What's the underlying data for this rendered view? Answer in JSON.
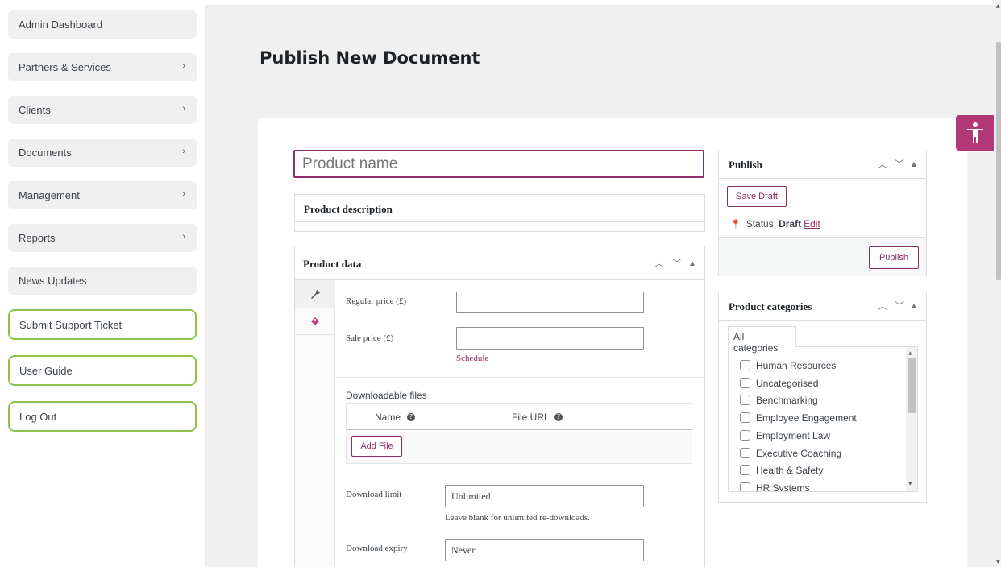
{
  "sidebar": {
    "items": [
      {
        "label": "Admin Dashboard",
        "has_chevron": false
      },
      {
        "label": "Partners & Services",
        "has_chevron": true
      },
      {
        "label": "Clients",
        "has_chevron": true
      },
      {
        "label": "Documents",
        "has_chevron": true
      },
      {
        "label": "Management",
        "has_chevron": true
      },
      {
        "label": "Reports",
        "has_chevron": true
      },
      {
        "label": "News Updates",
        "has_chevron": false
      },
      {
        "label": "Submit Support Ticket",
        "style": "outlined"
      },
      {
        "label": "User Guide",
        "style": "outlined"
      },
      {
        "label": "Log Out",
        "style": "outlined"
      }
    ],
    "chevron": "›"
  },
  "page": {
    "title": "Publish New Document"
  },
  "product": {
    "name_placeholder": "Product name",
    "description_title": "Product description"
  },
  "product_data": {
    "title": "Product data",
    "regular_price_label": "Regular price (£)",
    "sale_price_label": "Sale price (£)",
    "schedule_link": "Schedule",
    "downloadable_files_label": "Downloadable files",
    "col_name": "Name",
    "col_file_url": "File URL",
    "add_file_button": "Add File",
    "download_limit_label": "Download limit",
    "download_limit_value": "Unlimited",
    "download_limit_hint": "Leave blank for unlimited re-downloads.",
    "download_expiry_label": "Download expiry",
    "download_expiry_value": "Never"
  },
  "publish": {
    "title": "Publish",
    "save_draft": "Save Draft",
    "status_label": "Status:",
    "status_value": "Draft",
    "edit_link": "Edit",
    "publish_button": "Publish"
  },
  "categories": {
    "title": "Product categories",
    "tab": "All categories",
    "items": [
      "Human Resources",
      "Uncategorised",
      "Benchmarking",
      "Employee Engagement",
      "Employment Law",
      "Executive Coaching",
      "Health & Safety",
      "HR Systems"
    ]
  },
  "colors": {
    "accent": "#8c2f64",
    "a11y_bg": "#b13a76",
    "outline_green": "#8bc34a"
  },
  "icons": {
    "accessibility": "accessibility-icon",
    "wrench": "wrench-icon",
    "tag": "tag-icon",
    "pin": "pin-icon",
    "help": "help-icon"
  }
}
